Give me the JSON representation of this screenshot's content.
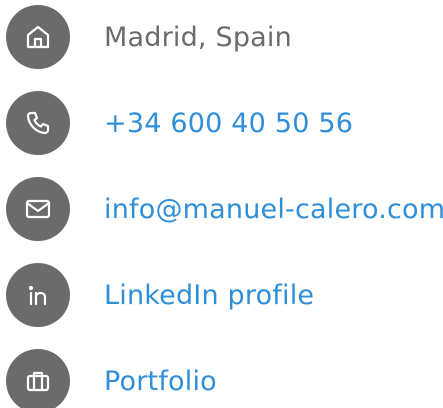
{
  "contacts": {
    "location": {
      "text": "Madrid, Spain",
      "icon": "home-icon"
    },
    "phone": {
      "text": "+34 600 40 50 56",
      "icon": "phone-icon"
    },
    "email": {
      "text": "info@manuel-calero.com",
      "icon": "mail-icon"
    },
    "linkedin": {
      "text": "LinkedIn profile",
      "icon": "linkedin-icon"
    },
    "portfolio": {
      "text": "Portfolio",
      "icon": "briefcase-icon"
    }
  },
  "colors": {
    "icon_bg": "#6b6b6b",
    "text_muted": "#6b6b6b",
    "link": "#2f8fd8"
  }
}
